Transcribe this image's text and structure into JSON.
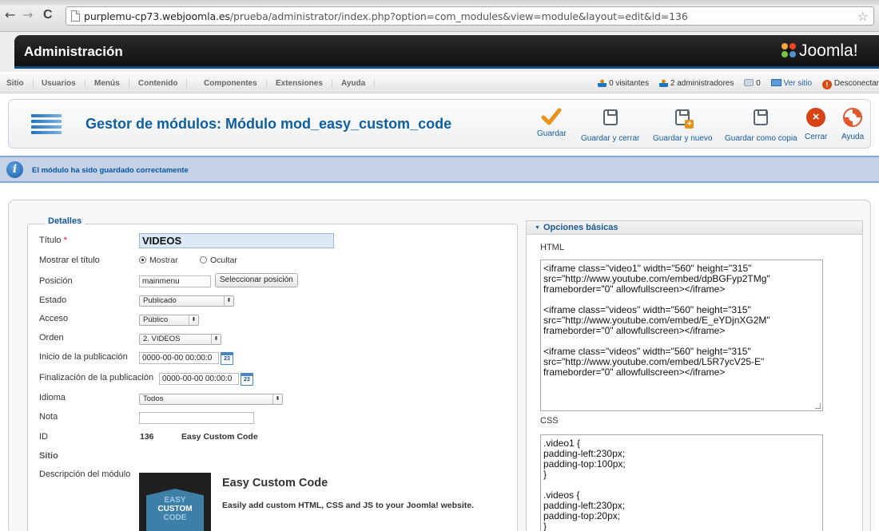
{
  "browser": {
    "back": "←",
    "forward": "→",
    "reload": "C",
    "url_host": "purplemu-cp73.webjoomla.es",
    "url_path": "/prueba/administrator/index.php?option=com_modules&view=module&layout=edit&id=136",
    "star": "☆"
  },
  "header": {
    "title": "Administración",
    "logo_text": "Joomla!"
  },
  "menu": {
    "items": [
      "Sitio",
      "Usuarios",
      "Menús",
      "Contenido",
      "Componentes",
      "Extensiones",
      "Ayuda"
    ]
  },
  "status": {
    "visitors": "0 visitantes",
    "admins": "2 administradores",
    "messages": "0",
    "view_site": "Ver sitio",
    "logout": "Desconectar"
  },
  "toolbar": {
    "page_title": "Gestor de módulos: Módulo mod_easy_custom_code",
    "save": "Guardar",
    "save_close": "Guardar y cerrar",
    "save_new": "Guardar y nuevo",
    "save_copy": "Guardar como copia",
    "close": "Cerrar",
    "help": "Ayuda"
  },
  "message": {
    "text": "El módulo ha sido guardado correctamente"
  },
  "details": {
    "legend": "Detalles",
    "title_label": "Título",
    "title_required": "*",
    "title_value": "VIDEOS",
    "show_title_label": "Mostrar el título",
    "show_option": "Mostrar",
    "hide_option": "Ocultar",
    "position_label": "Posición",
    "position_value": "mainmenu",
    "select_position": "Seleccionar posición",
    "state_label": "Estado",
    "state_value": "Publicado",
    "access_label": "Acceso",
    "access_value": "Público",
    "order_label": "Orden",
    "order_value": "2. VIDEOS",
    "publish_up_label": "Inicio de la publicación",
    "publish_up_value": "0000-00-00 00:00:0",
    "publish_down_label": "Finalización de la publicación",
    "publish_down_value": "0000-00-00 00:00:0",
    "calendar_day": "23",
    "language_label": "Idioma",
    "language_value": "Todos",
    "note_label": "Nota",
    "note_value": "",
    "id_label": "ID",
    "id_value": "136",
    "module_type": "Easy Custom Code",
    "site_label": "Sitio",
    "description_label": "Descripción del módulo",
    "module_title": "Easy Custom Code",
    "module_desc": "Easily add custom HTML, CSS and JS to your Joomla! website.",
    "logo_line1": "EASY",
    "logo_line2": "CUSTOM",
    "logo_line3": "CODE"
  },
  "options": {
    "header": "Opciones básicas",
    "html_label": "HTML",
    "html_value": "<iframe class=\"video1\" width=\"560\" height=\"315\"\nsrc=\"http://www.youtube.com/embed/dpBGFyp2TMg\"\nframeborder=\"0\" allowfullscreen></iframe>\n\n<iframe class=\"videos\" width=\"560\" height=\"315\"\nsrc=\"http://www.youtube.com/embed/E_eYDjnXG2M\"\nframeborder=\"0\" allowfullscreen></iframe>\n\n<iframe class=\"videos\" width=\"560\" height=\"315\"\nsrc=\"http://www.youtube.com/embed/L5R7ycV25-E\"\nframeborder=\"0\" allowfullscreen></iframe>",
    "css_label": "CSS",
    "css_value": ".video1 {\npadding-left:230px;\npadding-top:100px;\n}\n\n.videos {\npadding-left:230px;\npadding-top:20px;\n}"
  },
  "colors": {
    "accent": "#0f5fa0",
    "message_bg": "#c3d2e5",
    "header_bg": "#111111"
  }
}
